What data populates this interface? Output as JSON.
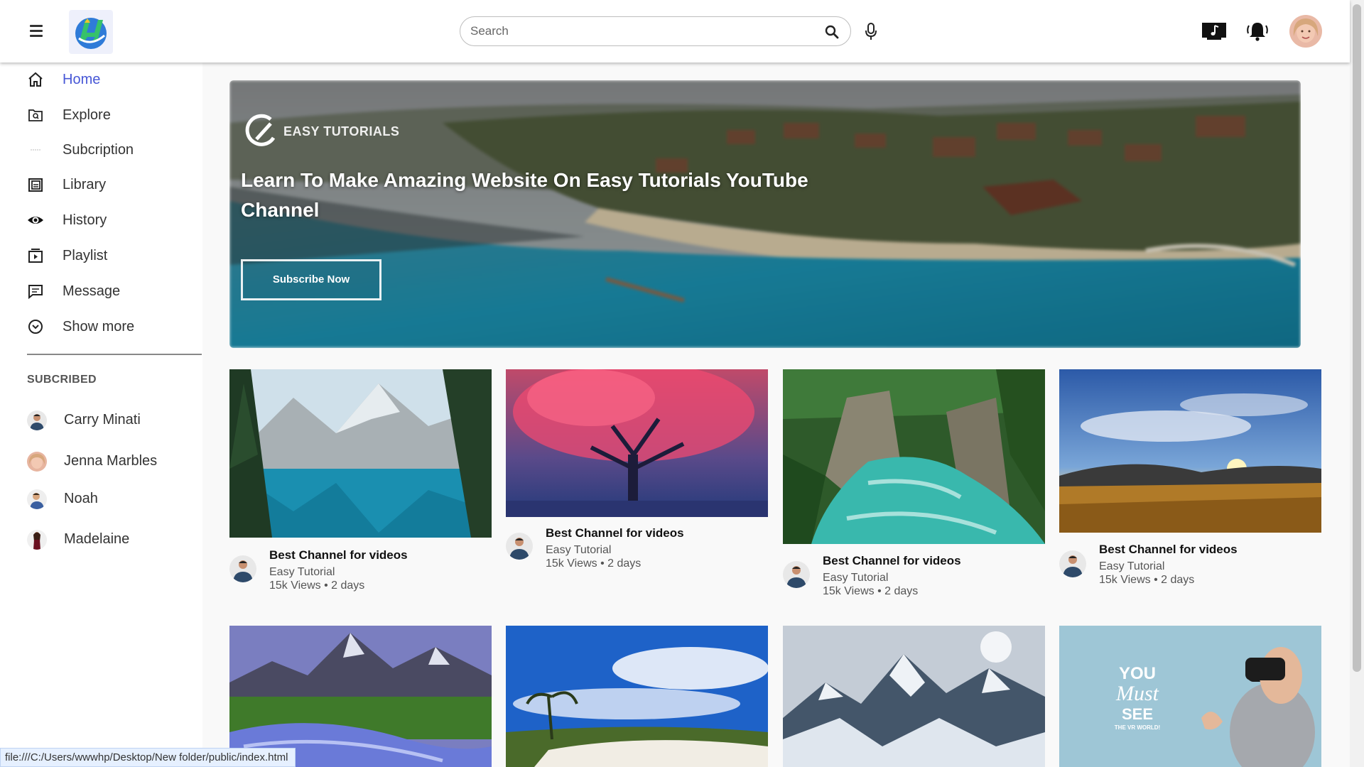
{
  "header": {
    "menu_icon": "hamburger-menu-icon",
    "logo_icon": "app-logo-icon",
    "search": {
      "placeholder": "Search",
      "value": ""
    },
    "icons": [
      "search-icon",
      "microphone-icon",
      "music-note-icon",
      "notification-bell-icon"
    ],
    "avatar": "user-avatar"
  },
  "sidebar": {
    "items": [
      {
        "label": "Home",
        "icon": "home-icon",
        "active": true
      },
      {
        "label": "Explore",
        "icon": "explore-icon"
      },
      {
        "label": "Subcription",
        "icon": "subscription-icon"
      },
      {
        "label": "Library",
        "icon": "library-icon"
      },
      {
        "label": "History",
        "icon": "history-eye-icon"
      },
      {
        "label": "Playlist",
        "icon": "playlist-icon"
      },
      {
        "label": "Message",
        "icon": "message-icon"
      },
      {
        "label": "Show more",
        "icon": "chevron-down-circle-icon"
      }
    ],
    "subscribed_heading": "SUBCRIBED",
    "subscriptions": [
      {
        "name": "Carry Minati"
      },
      {
        "name": "Jenna Marbles"
      },
      {
        "name": "Noah"
      },
      {
        "name": "Madelaine"
      }
    ]
  },
  "banner": {
    "brand": "EASY TUTORIALS",
    "title": "Learn To Make Amazing Website On Easy Tutorials YouTube Channel",
    "button": "Subscribe Now"
  },
  "videos": [
    {
      "title": "Best Channel for videos",
      "channel": "Easy Tutorial",
      "meta": "15k Views • 2 days",
      "scene": "lake-mountains"
    },
    {
      "title": "Best Channel for videos",
      "channel": "Easy Tutorial",
      "meta": "15k Views • 2 days",
      "scene": "red-tree"
    },
    {
      "title": "Best Channel for videos",
      "channel": "Easy Tutorial",
      "meta": "15k Views • 2 days",
      "scene": "river-canyon"
    },
    {
      "title": "Best Channel for videos",
      "channel": "Easy Tutorial",
      "meta": "15k Views • 2 days",
      "scene": "sunset-field"
    },
    {
      "scene": "mountain-stream"
    },
    {
      "scene": "tropical-beach"
    },
    {
      "scene": "snowy-mountains"
    },
    {
      "scene": "vr-headset-ad",
      "text_lines": [
        "YOU",
        "Must",
        "SEE",
        "THE VR WORLD!"
      ]
    }
  ],
  "status_bar": {
    "url": "file:///C:/Users/wwwhp/Desktop/New folder/public/index.html"
  },
  "colors": {
    "accent": "#4757d6",
    "text": "#333333",
    "muted": "#555555"
  }
}
